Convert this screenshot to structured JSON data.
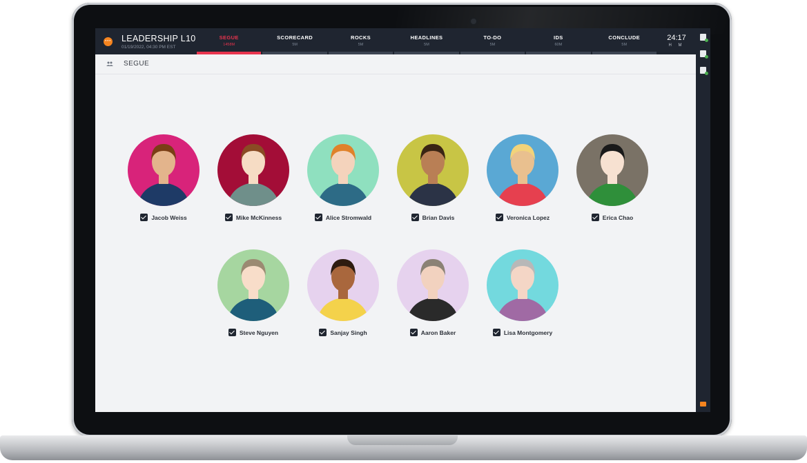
{
  "meeting": {
    "title": "LEADERSHIP L10",
    "datetime": "01/19/2022, 04:30 PM EST",
    "menu_icon": "ellipsis-icon",
    "accent": "#f5841f"
  },
  "tabs": [
    {
      "label": "SEGUE",
      "duration": "1458M",
      "active": true
    },
    {
      "label": "SCORECARD",
      "duration": "5M",
      "active": false
    },
    {
      "label": "ROCKS",
      "duration": "5M",
      "active": false
    },
    {
      "label": "HEADLINES",
      "duration": "5M",
      "active": false
    },
    {
      "label": "TO-DO",
      "duration": "5M",
      "active": false
    },
    {
      "label": "IDS",
      "duration": "60M",
      "active": false
    },
    {
      "label": "CONCLUDE",
      "duration": "5M",
      "active": false
    }
  ],
  "timer": {
    "value": "24:17",
    "units": "H M"
  },
  "section": {
    "title": "SEGUE",
    "icon": "people-icon"
  },
  "right_rail": [
    "add-page-icon",
    "checklist-icon",
    "notes-icon",
    "chat-icon"
  ],
  "attendees": [
    {
      "name": "Jacob Weiss",
      "checked": true,
      "bg": "#d8237a"
    },
    {
      "name": "Mike McKinness",
      "checked": true,
      "bg": "#a30d37"
    },
    {
      "name": "Alice Stromwald",
      "checked": true,
      "bg": "#8fe0bf"
    },
    {
      "name": "Brian Davis",
      "checked": true,
      "bg": "#c8c545"
    },
    {
      "name": "Veronica Lopez",
      "checked": true,
      "bg": "#5aa8d4"
    },
    {
      "name": "Erica Chao",
      "checked": true,
      "bg": "#7a7266"
    },
    {
      "name": "Steve Nguyen",
      "checked": true,
      "bg": "#a6d6a0"
    },
    {
      "name": "Sanjay Singh",
      "checked": true,
      "bg": "#e6d2ee"
    },
    {
      "name": "Aaron Baker",
      "checked": true,
      "bg": "#e6d2ee"
    },
    {
      "name": "Lisa Montgomery",
      "checked": true,
      "bg": "#73d9de"
    }
  ],
  "colors": {
    "active_tab": "#e8344e",
    "topbar": "#1f2530",
    "canvas": "#f2f3f5"
  }
}
